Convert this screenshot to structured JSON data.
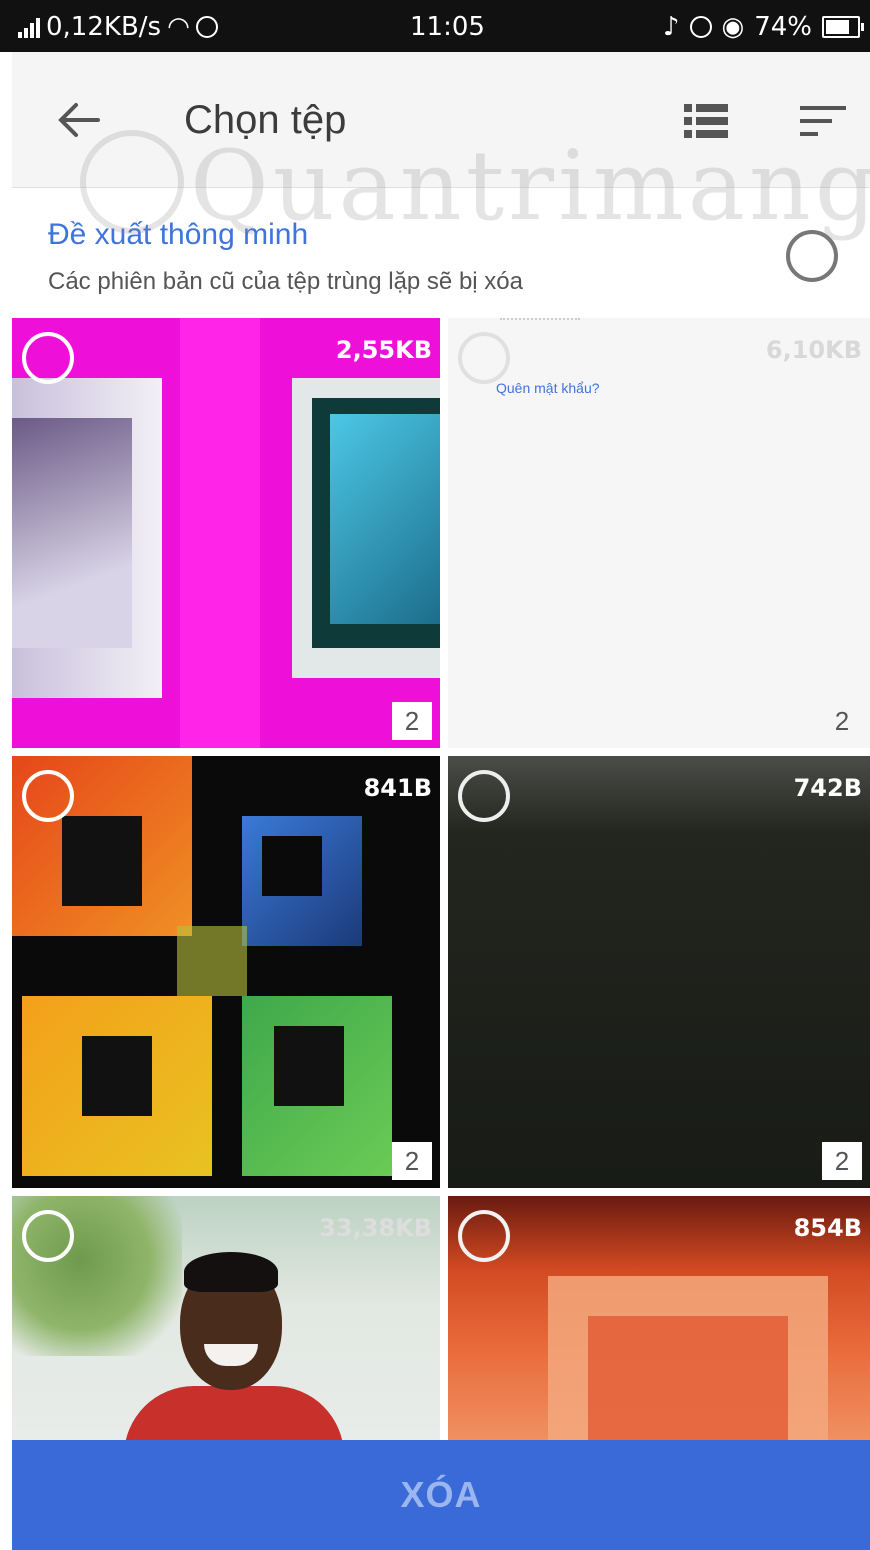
{
  "status_bar": {
    "net_speed": "0,12KB/s",
    "time": "11:05",
    "battery": "74%",
    "battery_level": 0.74,
    "icons": [
      "signal-icon",
      "wifi-icon",
      "sync-icon",
      "silent-icon",
      "alarm-icon",
      "eye-icon",
      "battery-icon"
    ]
  },
  "app_bar": {
    "title": "Chọn tệp",
    "icons": [
      "back-arrow-icon",
      "list-view-icon",
      "sort-icon"
    ]
  },
  "smart_suggestion": {
    "title": "Đề xuất thông minh",
    "subtitle": "Các phiên bản cũ của tệp trùng lặp sẽ bị xóa"
  },
  "watermark": "Quantrimang",
  "files": [
    {
      "size": "2,55KB",
      "count": "2"
    },
    {
      "size": "6,10KB",
      "count": "2",
      "link_text": "Quên mật khẩu?"
    },
    {
      "size": "841B",
      "count": "2"
    },
    {
      "size": "742B",
      "count": "2"
    },
    {
      "size": "33,38KB"
    },
    {
      "size": "854B"
    }
  ],
  "actions": {
    "delete_label": "XÓA"
  },
  "colors": {
    "accent": "#3f74dd",
    "delete_bar": "#3a69d8",
    "delete_text": "#9bb6ee",
    "status_bar": "#111111"
  }
}
